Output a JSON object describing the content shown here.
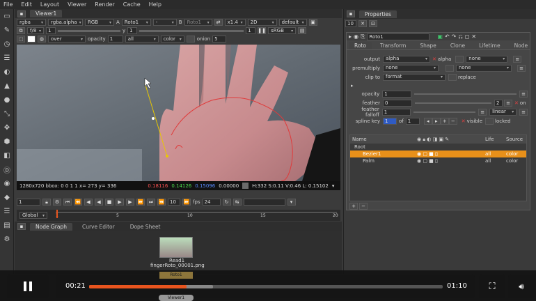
{
  "menubar": [
    "File",
    "Edit",
    "Layout",
    "Viewer",
    "Render",
    "Cache",
    "Help"
  ],
  "viewer": {
    "tab_title": "Viewer1",
    "channels": "rgba",
    "channel_alpha": "rgba.alpha",
    "colorspace": "RGB",
    "input_a_label": "A",
    "input_a": "Roto1",
    "dash": "-",
    "input_b_label": "B",
    "input_b": "Roto1",
    "zoom": "x1.4",
    "view_mode": "2D",
    "lut": "default",
    "frame_ratio": "f/8",
    "gain": "1",
    "y_label": "y",
    "y_value": "1",
    "gamma": "1",
    "display": "sRGB",
    "overlay": "over",
    "opacity_label": "opacity",
    "opacity_val": "1",
    "all": "all",
    "color": "color",
    "onion_label": "onion",
    "onion_val": "5",
    "info_left": "1280x720 bbox: 0 0 1 1 x= 273 y= 336",
    "info_r": "0.18116",
    "info_g": "0.14126",
    "info_b": "0.15096",
    "info_a": "0.00000",
    "info_right": "H:332 S:0.11 V:0.46  L: 0.15102",
    "frame_current": "1",
    "frame_step": "10",
    "fps_label": "fps",
    "fps": "24",
    "range_mode": "Global",
    "timeline_ticks": [
      "1",
      "5",
      "10",
      "15",
      "20"
    ]
  },
  "properties": {
    "tab_title": "Properties",
    "max_panels": "10",
    "node_name": "Roto1",
    "tabs": [
      "Roto",
      "Transform",
      "Shape",
      "Clone",
      "Lifetime",
      "Node"
    ],
    "output_label": "output",
    "output_val": "alpha",
    "output_check": "alpha",
    "output_none": "none",
    "premult_label": "premultiply",
    "premult_val": "none",
    "premult_none": "none",
    "clip_label": "clip to",
    "clip_val": "format",
    "replace": "replace",
    "opacity_label": "opacity",
    "opacity_val": "1",
    "feather_label": "feather",
    "feather_val": "0",
    "feather_num": "2",
    "feather_on": "on",
    "falloff_label": "feather falloff",
    "falloff_val": "1",
    "falloff_type": "linear",
    "spline_label": "spline key",
    "spline_val": "1",
    "spline_of": "of",
    "spline_total": "1",
    "visible": "visible",
    "locked": "locked",
    "table_headers": [
      "Name",
      "Life",
      "Source"
    ],
    "rows": [
      {
        "name": "Root",
        "life": "",
        "source": ""
      },
      {
        "name": "Bezier1",
        "life": "all",
        "source": "color"
      },
      {
        "name": "Palm",
        "life": "all",
        "source": "color"
      }
    ],
    "add_btn": "+",
    "remove_btn": "−"
  },
  "nodegraph": {
    "tabs": [
      "Node Graph",
      "Curve Editor",
      "Dope Sheet"
    ],
    "read_name": "Read1",
    "read_file": "fingerRoto_00001.png",
    "roto_name": "Roto1",
    "roto_sub": "(alpha)",
    "viewer_name": "Viewer1"
  },
  "player": {
    "time_current": "00:21",
    "time_total": "01:10",
    "progress": 0.275,
    "buffered": 0.35,
    "accent": "#e8541e"
  }
}
